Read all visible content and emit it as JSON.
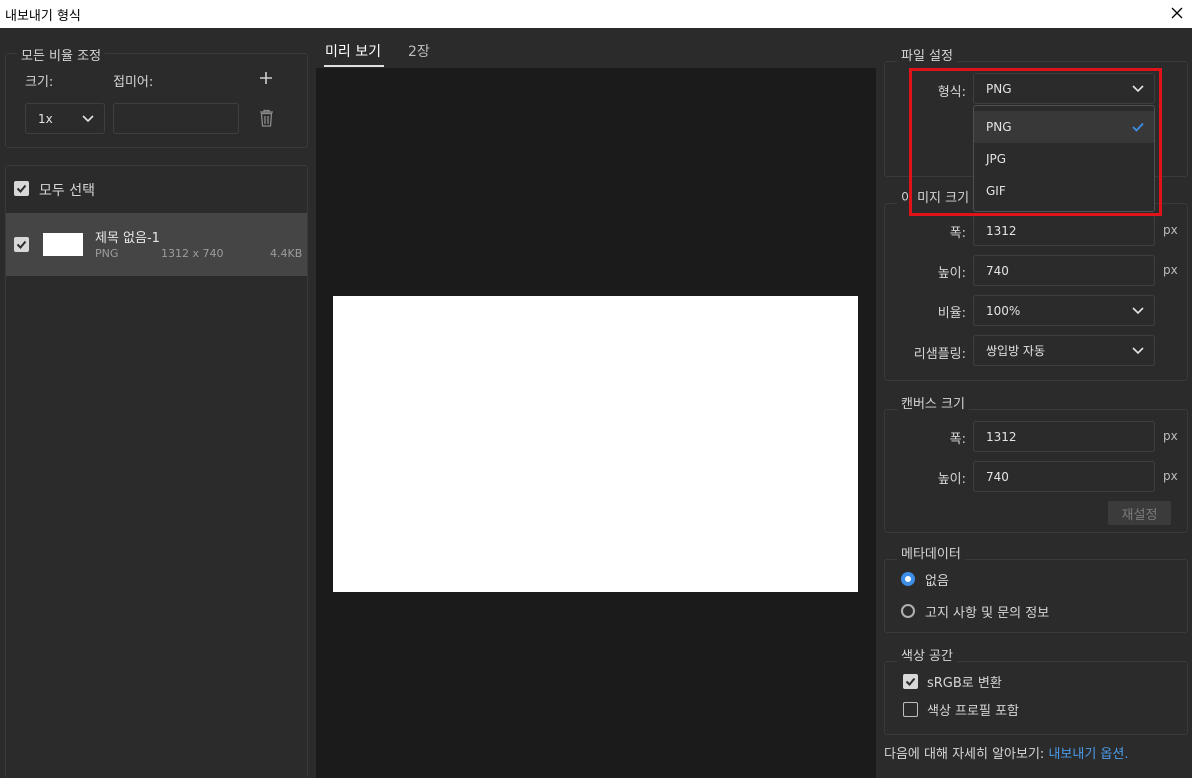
{
  "window": {
    "title": "내보내기 형식"
  },
  "left": {
    "scale_section": {
      "title": "모든 비율 조정",
      "size_label": "크기:",
      "suffix_label": "접미어:",
      "size_value": "1x",
      "suffix_value": ""
    },
    "select_all_label": "모두 선택",
    "item": {
      "name": "제목 없음-1",
      "format": "PNG",
      "dimensions": "1312 x 740",
      "filesize": "4.4KB"
    }
  },
  "center": {
    "tabs": [
      "미리 보기",
      "2장"
    ]
  },
  "right": {
    "file_settings": {
      "title": "파일 설정",
      "format_label": "형식:",
      "format_value": "PNG",
      "format_options": [
        "PNG",
        "JPG",
        "GIF"
      ]
    },
    "image_size": {
      "title": "이미지 크기",
      "title_visible": "이 미지 크기",
      "width_label": "폭:",
      "width_value": "1312",
      "height_label": "높이:",
      "height_value": "740",
      "scale_label": "비율:",
      "scale_value": "100%",
      "resample_label": "리샘플링:",
      "resample_value": "쌍입방 자동",
      "unit": "px"
    },
    "canvas_size": {
      "title": "캔버스 크기",
      "width_label": "폭:",
      "width_value": "1312",
      "height_label": "높이:",
      "height_value": "740",
      "unit": "px",
      "reset_label": "재설정"
    },
    "metadata": {
      "title": "메타데이터",
      "option_none": "없음",
      "option_copyright": "고지 사항 및 문의 정보"
    },
    "color_space": {
      "title": "색상 공간",
      "convert_srgb": "sRGB로 변환",
      "embed_profile": "색상 프로필 포함"
    },
    "footer": {
      "text": "다음에 대해 자세히 알아보기: ",
      "link": "내보내기 옵션."
    }
  },
  "colors": {
    "accent": "#3d8ee6",
    "highlight": "#e0131a",
    "link": "#4b9bea"
  }
}
